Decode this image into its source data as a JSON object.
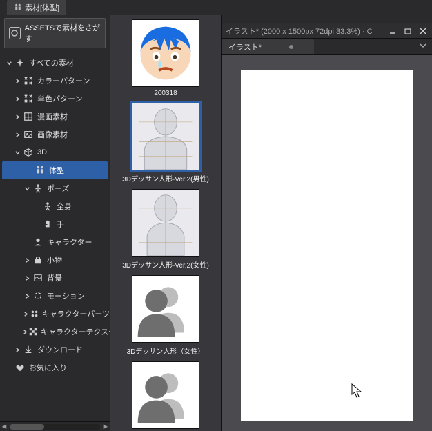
{
  "tab_header": {
    "label": "素材[体型]"
  },
  "assets_button": "ASSETSで素材をさがす",
  "sidebar": {
    "items": [
      {
        "label": "すべての素材",
        "icon": "sparkle",
        "chev": "down",
        "indent": 0
      },
      {
        "label": "カラーパターン",
        "icon": "pattern",
        "chev": "right",
        "indent": 1
      },
      {
        "label": "単色パターン",
        "icon": "pattern",
        "chev": "right",
        "indent": 1
      },
      {
        "label": "漫画素材",
        "icon": "panel",
        "chev": "right",
        "indent": 1
      },
      {
        "label": "画像素材",
        "icon": "image",
        "chev": "right",
        "indent": 1
      },
      {
        "label": "3D",
        "icon": "cube",
        "chev": "down",
        "indent": 1
      },
      {
        "label": "体型",
        "icon": "body",
        "chev": "",
        "indent": 2,
        "selected": true
      },
      {
        "label": "ポーズ",
        "icon": "person",
        "chev": "down",
        "indent": 2
      },
      {
        "label": "全身",
        "icon": "person",
        "chev": "",
        "indent": 3
      },
      {
        "label": "手",
        "icon": "hand",
        "chev": "",
        "indent": 3
      },
      {
        "label": "キャラクター",
        "icon": "char",
        "chev": "",
        "indent": 2
      },
      {
        "label": "小物",
        "icon": "bag",
        "chev": "right",
        "indent": 2
      },
      {
        "label": "背景",
        "icon": "bg",
        "chev": "right",
        "indent": 2
      },
      {
        "label": "モーション",
        "icon": "motion",
        "chev": "right",
        "indent": 2
      },
      {
        "label": "キャラクターパーツ",
        "icon": "parts",
        "chev": "right",
        "indent": 2
      },
      {
        "label": "キャラクターテクスチャ",
        "icon": "texture",
        "chev": "right",
        "indent": 2
      },
      {
        "label": "ダウンロード",
        "icon": "download",
        "chev": "right",
        "indent": 1
      },
      {
        "label": "お気に入り",
        "icon": "heart",
        "chev": "",
        "indent": 0
      }
    ]
  },
  "materials": [
    {
      "label": "200318",
      "kind": "avatar"
    },
    {
      "label": "3Dデッサン人形-Ver.2(男性)",
      "kind": "body-male",
      "selected": true
    },
    {
      "label": "3Dデッサン人形-Ver.2(女性)",
      "kind": "body-female"
    },
    {
      "label": "3Dデッサン人形（女性）",
      "kind": "silhouette"
    },
    {
      "label": "",
      "kind": "silhouette"
    }
  ],
  "canvas": {
    "title": "イラスト* (2000 x 1500px 72dpi 33.3%)  ·  C",
    "tab": "イラスト*"
  }
}
